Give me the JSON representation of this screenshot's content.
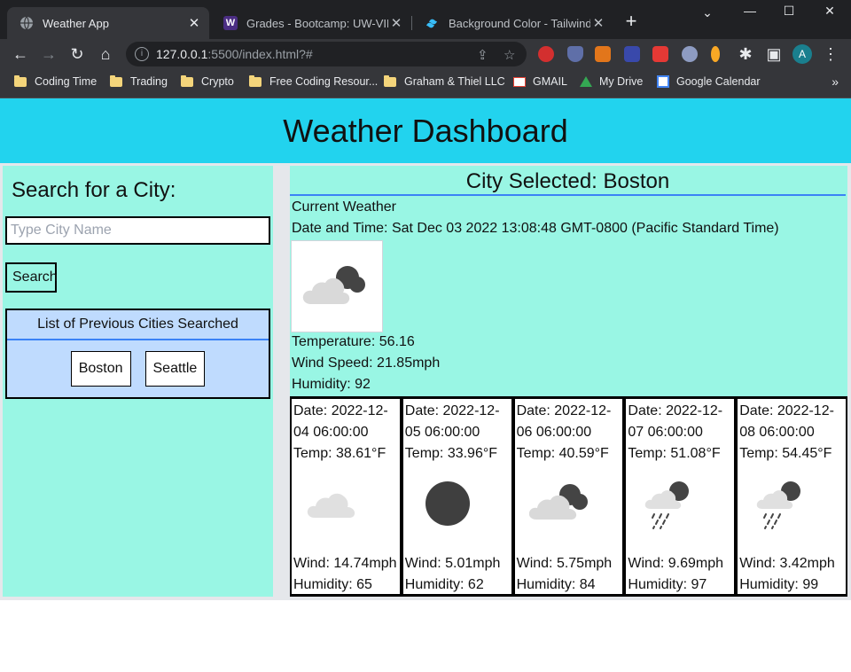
{
  "browser": {
    "tabs": [
      {
        "title": "Weather App",
        "active": true
      },
      {
        "title": "Grades - Bootcamp: UW-VIRT-",
        "active": false
      },
      {
        "title": "Background Color - Tailwind C",
        "active": false
      }
    ],
    "url_host": "127.0.0.1",
    "url_rest": ":5500/index.html?#",
    "bookmarks": [
      "Coding Time",
      "Trading",
      "Crypto",
      "Free Coding Resour...",
      "Graham & Thiel LLC",
      "GMAIL",
      "My Drive",
      "Google Calendar"
    ],
    "profile_initial": "A"
  },
  "header": {
    "title": "Weather Dashboard"
  },
  "sidebar": {
    "heading": "Search for a City:",
    "search_placeholder": "Type City Name",
    "search_label": "Search",
    "history_title": "List of Previous Cities Searched",
    "history": [
      "Boston",
      "Seattle"
    ]
  },
  "current": {
    "selected": "City Selected: Boston",
    "heading": "Current Weather",
    "datetime": "Date and Time: Sat Dec 03 2022 13:08:48 GMT-0800 (Pacific Standard Time)",
    "icon": "cloud-moon-icon",
    "temperature": "Temperature: 56.16",
    "wind": "Wind Speed: 21.85mph",
    "humidity": "Humidity: 92"
  },
  "forecast": [
    {
      "date": "Date: 2022-12-04 06:00:00",
      "temp": "Temp: 38.61°F",
      "icon": "cloud-icon",
      "wind": "Wind: 14.74mph",
      "humidity": "Humidity: 65"
    },
    {
      "date": "Date: 2022-12-05 06:00:00",
      "temp": "Temp: 33.96°F",
      "icon": "moon-icon",
      "wind": "Wind: 5.01mph",
      "humidity": "Humidity: 62"
    },
    {
      "date": "Date: 2022-12-06 06:00:00",
      "temp": "Temp: 40.59°F",
      "icon": "cloud-moon-icon",
      "wind": "Wind: 5.75mph",
      "humidity": "Humidity: 84"
    },
    {
      "date": "Date: 2022-12-07 06:00:00",
      "temp": "Temp: 51.08°F",
      "icon": "rain-moon-icon",
      "wind": "Wind: 9.69mph",
      "humidity": "Humidity: 97"
    },
    {
      "date": "Date: 2022-12-08 06:00:00",
      "temp": "Temp: 54.45°F",
      "icon": "rain-moon-icon",
      "wind": "Wind: 3.42mph",
      "humidity": "Humidity: 99"
    }
  ]
}
